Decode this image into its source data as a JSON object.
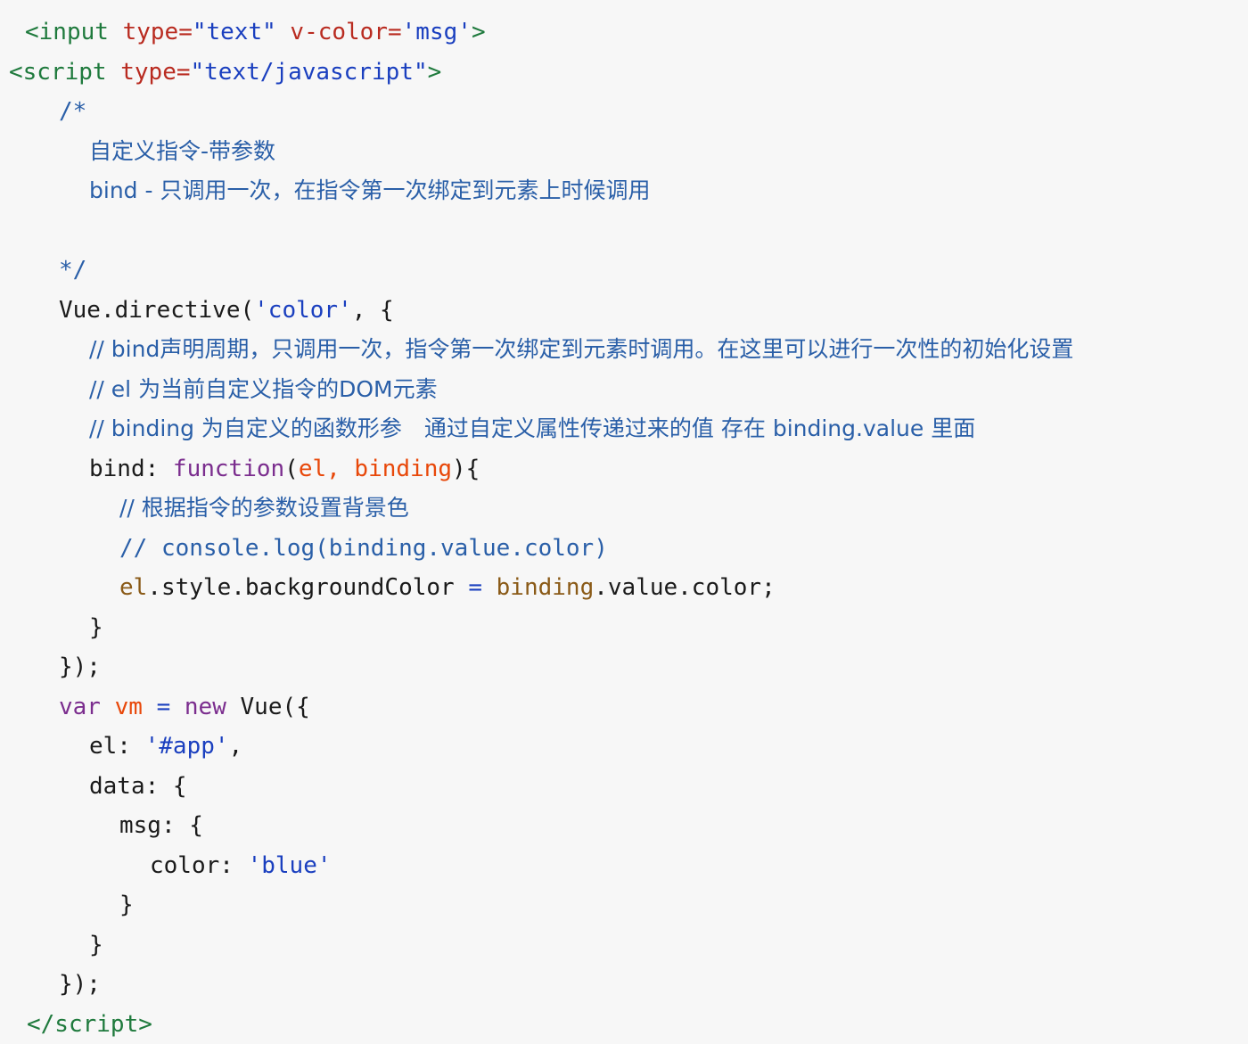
{
  "editor": {
    "language": "html-vue",
    "background_color": "#f7f7f7",
    "theme": "light",
    "font_size_px": 26
  },
  "palette": {
    "tag": "#1f7a3d",
    "attribute": "#b92b20",
    "string": "#1a3fbf",
    "comment": "#2a5fa8",
    "keyword": "#7b2d8e",
    "variable": "#e8480a",
    "property": "#8a5a17",
    "operator": "#1a3fbf",
    "plain": "#1a1a1a"
  },
  "code": {
    "l1_tag_open": "<input",
    "l1_attr_type": " type=",
    "l1_val_text": "\"text\"",
    "l1_attr_vcolor": " v-color=",
    "l1_val_msg": "'msg'",
    "l1_tag_close": ">",
    "l2_tag_open": "<script",
    "l2_attr_type": " type=",
    "l2_val_js": "\"text/javascript\"",
    "l2_tag_close": ">",
    "l3_comment_start": "/*",
    "l4_comment_title": "自定义指令-带参数",
    "l5_comment_bind": "bind - 只调用一次，在指令第一次绑定到元素上时候调用",
    "l6_blank": " ",
    "l7_comment_end": "*/",
    "l8_vue_directive": "Vue.directive(",
    "l8_directive_name": "'color'",
    "l8_tail": ", {",
    "l9_comment": "// bind声明周期，只调用一次，指令第一次绑定到元素时调用。在这里可以进行一次性的初始化设置",
    "l10_comment": "// el 为当前自定义指令的DOM元素",
    "l11_comment": "// binding 为自定义的函数形参　通过自定义属性传递过来的值 存在 binding.value 里面",
    "l12_bind_key": "bind: ",
    "l12_function_kw": "function",
    "l12_paren_open": "(",
    "l12_params": "el, binding",
    "l12_paren_close": "){",
    "l13_comment": "// 根据指令的参数设置背景色",
    "l14_comment": "// console.log(binding.value.color)",
    "l15_el": "el",
    "l15_style_path": ".style.backgroundColor ",
    "l15_equals": "=",
    "l15_binding": " binding",
    "l15_value_path": ".value.color;",
    "l16_close_brace": "}",
    "l17_close_directive": "});",
    "l18_var_kw": "var ",
    "l18_vm": "vm",
    "l18_equals": " = ",
    "l18_new_kw": "new ",
    "l18_vue_call": "Vue({",
    "l19_el_key": "el: ",
    "l19_el_value": "'#app'",
    "l19_comma": ",",
    "l20_data_key": "data: {",
    "l21_msg_key": "msg: {",
    "l22_color_key": "color: ",
    "l22_color_value": "'blue'",
    "l23_close_msg": "}",
    "l24_close_data": "}",
    "l25_close_vue": "});",
    "l26_script_close": "</script"
  },
  "script_close_suffix": ">"
}
